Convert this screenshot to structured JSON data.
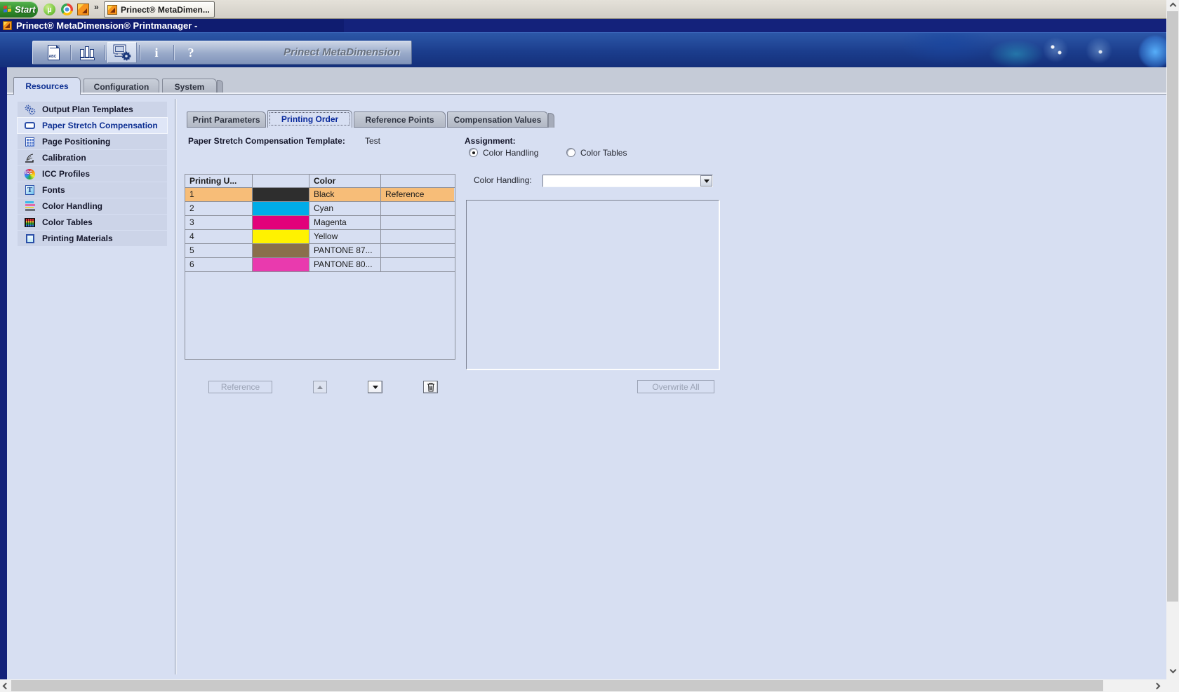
{
  "taskbar": {
    "start_label": "Start",
    "chevron": "»",
    "task_button_label": "Prinect® MetaDimen...",
    "quick_launch": [
      "utorrent-icon",
      "chrome-icon",
      "prinect-icon"
    ]
  },
  "title_bar": {
    "title": "Prinect® MetaDimension® Printmanager -"
  },
  "toolbar": {
    "logo": "Prinect MetaDimension",
    "info_glyph": "i",
    "help_glyph": "?",
    "icons": [
      "job-list-icon",
      "print-queues-icon",
      "resources-settings-icon",
      "info-icon",
      "help-icon"
    ],
    "selected_icon": "resources-settings-icon"
  },
  "main_tabs": [
    {
      "label": "Resources",
      "selected": true
    },
    {
      "label": "Configuration",
      "selected": false
    },
    {
      "label": "System",
      "selected": false
    }
  ],
  "sidebar": {
    "items": [
      {
        "label": "Output Plan Templates",
        "selected": false
      },
      {
        "label": "Paper Stretch Compensation",
        "selected": true
      },
      {
        "label": "Page Positioning",
        "selected": false
      },
      {
        "label": "Calibration",
        "selected": false
      },
      {
        "label": "ICC Profiles",
        "selected": false
      },
      {
        "label": "Fonts",
        "selected": false
      },
      {
        "label": "Color Handling",
        "selected": false
      },
      {
        "label": "Color Tables",
        "selected": false
      },
      {
        "label": "Printing Materials",
        "selected": false
      }
    ]
  },
  "inner_tabs": [
    {
      "label": "Print Parameters",
      "selected": false
    },
    {
      "label": "Printing Order",
      "selected": true
    },
    {
      "label": "Reference Points",
      "selected": false
    },
    {
      "label": "Compensation Values",
      "selected": false
    }
  ],
  "content": {
    "template_label": "Paper Stretch Compensation Template:",
    "template_value": "Test",
    "assignment_label": "Assignment:",
    "radios": [
      {
        "label": "Color Handling",
        "selected": true
      },
      {
        "label": "Color Tables",
        "selected": false
      }
    ],
    "color_handling_label": "Color Handling:",
    "color_handling_value": "",
    "table": {
      "headers": [
        "Printing U...",
        "",
        "Color",
        ""
      ],
      "rows": [
        {
          "unit": "1",
          "swatch": "#2e2e2e",
          "color": "Black",
          "reference": "Reference",
          "selected": true
        },
        {
          "unit": "2",
          "swatch": "#00ace8",
          "color": "Cyan",
          "reference": "",
          "selected": false
        },
        {
          "unit": "3",
          "swatch": "#e2007a",
          "color": "Magenta",
          "reference": "",
          "selected": false
        },
        {
          "unit": "4",
          "swatch": "#fff200",
          "color": "Yellow",
          "reference": "",
          "selected": false
        },
        {
          "unit": "5",
          "swatch": "#8a6f4b",
          "color": "PANTONE 87...",
          "reference": "",
          "selected": false
        },
        {
          "unit": "6",
          "swatch": "#e93aae",
          "color": "PANTONE 80...",
          "reference": "",
          "selected": false
        }
      ],
      "selected_row_color": "#f7bd78"
    },
    "buttons": {
      "reference": "Reference",
      "overwrite_all": "Overwrite All"
    }
  }
}
